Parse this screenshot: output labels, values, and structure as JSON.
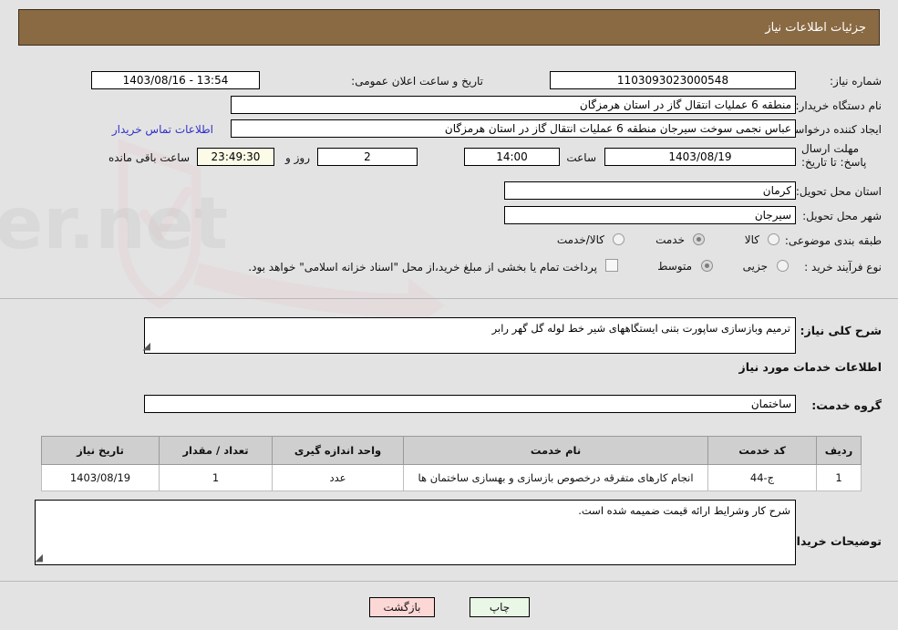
{
  "header": {
    "title": "جزئیات اطلاعات نیاز"
  },
  "colors": {
    "header_bg": "#8a6a43",
    "link": "#3130c8",
    "back_btn": "#fbd7d5",
    "print_btn": "#e9f7e6",
    "table_header": "#cfcfcf",
    "page_bg": "#e3e3e3"
  },
  "form": {
    "need_number_label": "شماره نیاز:",
    "need_number_value": "1103093023000548",
    "announce_label": "تاریخ و ساعت اعلان عمومی:",
    "announce_value": "13:54 - 1403/08/16",
    "buyer_org_label": "نام دستگاه خریدار:",
    "buyer_org_value": "منطقه 6 عملیات انتقال گاز در استان هرمزگان",
    "creator_label": "ایجاد کننده درخواست:",
    "creator_value": "عباس نجمی سوخت سیرجان منطقه 6 عملیات انتقال گاز در استان هرمزگان",
    "contact_link": "اطلاعات تماس خریدار",
    "deadline_label": "مهلت ارسال پاسخ: تا تاریخ:",
    "deadline_date": "1403/08/19",
    "hour_label": "ساعت",
    "deadline_time": "14:00",
    "remaining_days": "2",
    "days_and_label": "روز و",
    "remaining_time": "23:49:30",
    "remaining_suffix": "ساعت باقی مانده",
    "province_label": "استان محل تحویل:",
    "province_value": "کرمان",
    "city_label": "شهر محل تحویل:",
    "city_value": "سیرجان",
    "category_label": "طبقه بندی موضوعی:",
    "category_options": [
      "کالا",
      "خدمت",
      "کالا/خدمت"
    ],
    "category_selected": "خدمت",
    "process_label": "نوع فرآیند خرید :",
    "process_options": [
      "جزیی",
      "متوسط"
    ],
    "process_selected": "متوسط",
    "treasury_note": "پرداخت تمام یا بخشی از مبلغ خرید،از محل \"اسناد خزانه اسلامی\" خواهد بود."
  },
  "summary": {
    "label": "شرح کلی نیاز:",
    "value": "ترمیم وبازسازی ساپورت بتنی ایستگاههای شیر خط لوله گل گهر رابر"
  },
  "service_section": {
    "title": "اطلاعات خدمات مورد نیاز",
    "group_label": "گروه خدمت:",
    "group_value": "ساختمان"
  },
  "table": {
    "headers": [
      "ردیف",
      "کد خدمت",
      "نام خدمت",
      "واحد اندازه گیری",
      "تعداد / مقدار",
      "تاریخ نیاز"
    ],
    "rows": [
      {
        "row": "1",
        "code": "ج-44",
        "name": "انجام کارهای متفرقه درخصوص بازسازی و بهسازی ساختمان ها",
        "unit": "عدد",
        "qty": "1",
        "date": "1403/08/19"
      }
    ]
  },
  "notes": {
    "label": "توضیحات خریدار:",
    "value": "شرح کار وشرایط ارائه قیمت ضمیمه شده است."
  },
  "buttons": {
    "back": "بازگشت",
    "print": "چاپ"
  },
  "watermark": {
    "text": "AriaTender.net"
  }
}
